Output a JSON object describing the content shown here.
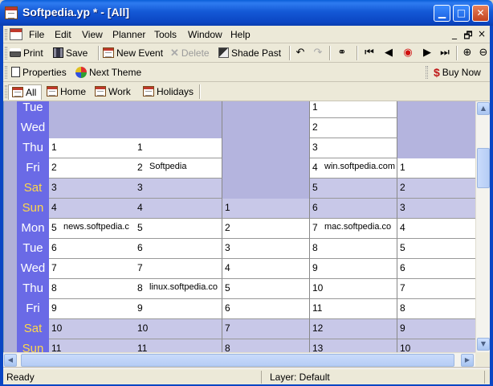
{
  "window": {
    "title": "Softpedia.yp * - [All]",
    "minimize_glyph": "▁",
    "maximize_glyph": "□",
    "close_glyph": "✕"
  },
  "menu": {
    "items": [
      "File",
      "Edit",
      "View",
      "Planner",
      "Tools",
      "Window",
      "Help"
    ],
    "mdi_minimize": "_",
    "mdi_restore": "🗗",
    "mdi_close": "×"
  },
  "toolbar1": {
    "print": "Print",
    "save": "Save",
    "new_event": "New Event",
    "delete": "Delete",
    "shade_past": "Shade Past"
  },
  "toolbar2": {
    "properties": "Properties",
    "next_theme": "Next Theme",
    "buy_now": "Buy Now"
  },
  "tabs": [
    {
      "label": "All",
      "active": true
    },
    {
      "label": "Home",
      "active": false
    },
    {
      "label": "Work",
      "active": false
    },
    {
      "label": "Holidays",
      "active": false
    }
  ],
  "days": [
    {
      "name": "Tue",
      "weekend": false
    },
    {
      "name": "Wed",
      "weekend": false
    },
    {
      "name": "Thu",
      "weekend": false
    },
    {
      "name": "Fri",
      "weekend": false
    },
    {
      "name": "Sat",
      "weekend": true
    },
    {
      "name": "Sun",
      "weekend": true
    },
    {
      "name": "Mon",
      "weekend": false
    },
    {
      "name": "Tue",
      "weekend": false
    },
    {
      "name": "Wed",
      "weekend": false
    },
    {
      "name": "Thu",
      "weekend": false
    },
    {
      "name": "Fri",
      "weekend": false
    },
    {
      "name": "Sat",
      "weekend": true
    },
    {
      "name": "Sun",
      "weekend": true
    }
  ],
  "months": [
    {
      "cells": [
        {
          "num": "",
          "event": ""
        },
        {
          "num": "",
          "event": ""
        },
        {
          "num": "1",
          "event": ""
        },
        {
          "num": "2",
          "event": ""
        },
        {
          "num": "3",
          "event": ""
        },
        {
          "num": "4",
          "event": ""
        },
        {
          "num": "5",
          "event": "news.softpedia.c"
        },
        {
          "num": "6",
          "event": ""
        },
        {
          "num": "7",
          "event": ""
        },
        {
          "num": "8",
          "event": ""
        },
        {
          "num": "9",
          "event": ""
        },
        {
          "num": "10",
          "event": ""
        },
        {
          "num": "11",
          "event": ""
        }
      ]
    },
    {
      "cells": [
        {
          "num": "",
          "event": ""
        },
        {
          "num": "",
          "event": ""
        },
        {
          "num": "1",
          "event": ""
        },
        {
          "num": "2",
          "event": "Softpedia"
        },
        {
          "num": "3",
          "event": ""
        },
        {
          "num": "4",
          "event": ""
        },
        {
          "num": "5",
          "event": ""
        },
        {
          "num": "6",
          "event": ""
        },
        {
          "num": "7",
          "event": ""
        },
        {
          "num": "8",
          "event": "linux.softpedia.co"
        },
        {
          "num": "9",
          "event": ""
        },
        {
          "num": "10",
          "event": ""
        },
        {
          "num": "11",
          "event": ""
        }
      ]
    },
    {
      "cells": [
        {
          "num": "",
          "event": ""
        },
        {
          "num": "",
          "event": ""
        },
        {
          "num": "",
          "event": ""
        },
        {
          "num": "",
          "event": ""
        },
        {
          "num": "",
          "event": ""
        },
        {
          "num": "1",
          "event": ""
        },
        {
          "num": "2",
          "event": ""
        },
        {
          "num": "3",
          "event": ""
        },
        {
          "num": "4",
          "event": ""
        },
        {
          "num": "5",
          "event": ""
        },
        {
          "num": "6",
          "event": ""
        },
        {
          "num": "7",
          "event": ""
        },
        {
          "num": "8",
          "event": ""
        }
      ]
    },
    {
      "cells": [
        {
          "num": "1",
          "event": ""
        },
        {
          "num": "2",
          "event": ""
        },
        {
          "num": "3",
          "event": ""
        },
        {
          "num": "4",
          "event": "win.softpedia.com"
        },
        {
          "num": "5",
          "event": ""
        },
        {
          "num": "6",
          "event": ""
        },
        {
          "num": "7",
          "event": "mac.softpedia.co"
        },
        {
          "num": "8",
          "event": ""
        },
        {
          "num": "9",
          "event": ""
        },
        {
          "num": "10",
          "event": ""
        },
        {
          "num": "11",
          "event": ""
        },
        {
          "num": "12",
          "event": ""
        },
        {
          "num": "13",
          "event": ""
        }
      ]
    },
    {
      "cells": [
        {
          "num": "",
          "event": ""
        },
        {
          "num": "",
          "event": ""
        },
        {
          "num": "",
          "event": ""
        },
        {
          "num": "1",
          "event": ""
        },
        {
          "num": "2",
          "event": ""
        },
        {
          "num": "3",
          "event": ""
        },
        {
          "num": "4",
          "event": ""
        },
        {
          "num": "5",
          "event": ""
        },
        {
          "num": "6",
          "event": ""
        },
        {
          "num": "7",
          "event": ""
        },
        {
          "num": "8",
          "event": ""
        },
        {
          "num": "9",
          "event": ""
        },
        {
          "num": "10",
          "event": ""
        }
      ]
    }
  ],
  "status": {
    "left": "Ready",
    "layer": "Layer: Default"
  },
  "colors": {
    "weekday_text": "#ffffff",
    "weekend_text": "#ffd84a",
    "day_column_bg": "#6a6ae6",
    "weekday_cell": "#ffffff",
    "weekend_cell": "#c8c8e8",
    "empty_cell": "#b4b4de"
  }
}
